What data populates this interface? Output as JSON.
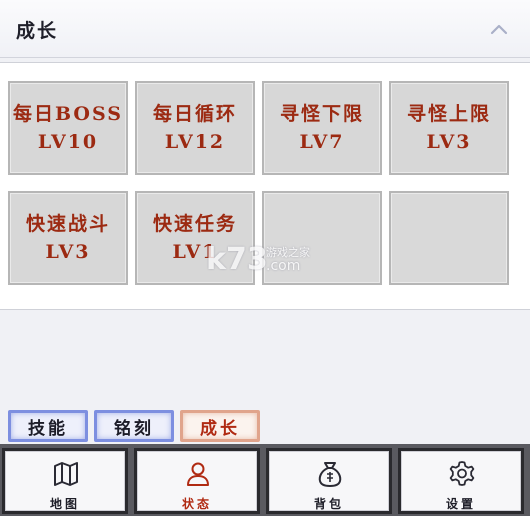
{
  "header": {
    "title": "成长"
  },
  "tiles": [
    {
      "name": "每日BOSS",
      "level": "LV10"
    },
    {
      "name": "每日循环",
      "level": "LV12"
    },
    {
      "name": "寻怪下限",
      "level": "LV7"
    },
    {
      "name": "寻怪上限",
      "level": "LV3"
    },
    {
      "name": "快速战斗",
      "level": "LV3"
    },
    {
      "name": "快速任务",
      "level": "LV1"
    }
  ],
  "watermark": {
    "logo": "k73",
    "tagline": "游戏之家",
    "domain": ".com"
  },
  "subtabs": [
    {
      "label": "技能",
      "active": false
    },
    {
      "label": "铭刻",
      "active": false
    },
    {
      "label": "成长",
      "active": true
    }
  ],
  "nav": [
    {
      "label": "地图",
      "icon": "map-icon",
      "active": false
    },
    {
      "label": "状态",
      "icon": "person-icon",
      "active": true
    },
    {
      "label": "背包",
      "icon": "bag-icon",
      "active": false
    },
    {
      "label": "设置",
      "icon": "gear-icon",
      "active": false
    }
  ],
  "colors": {
    "accent": "#b02a12",
    "tile_text": "#9c2a12",
    "tab_blue": "#7d8fe0",
    "tab_active": "#e0a48c"
  }
}
